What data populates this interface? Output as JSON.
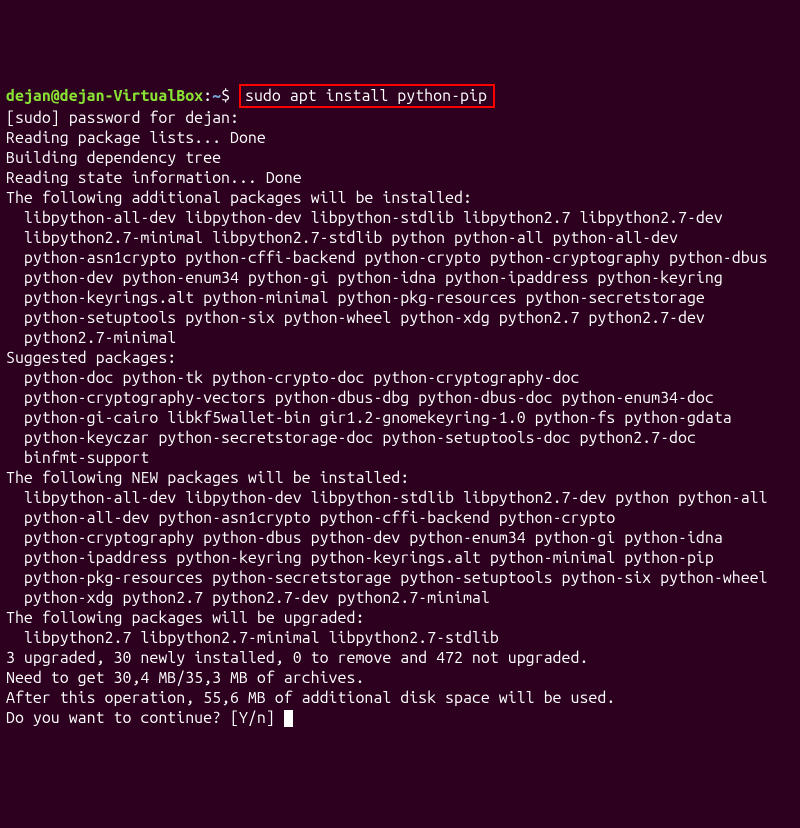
{
  "prompt": {
    "user": "dejan@dejan-VirtualBox",
    "separator": ":",
    "path": "~",
    "dollar": "$ "
  },
  "command": "sudo apt install python-pip",
  "lines": [
    "[sudo] password for dejan:",
    "Reading package lists... Done",
    "Building dependency tree",
    "Reading state information... Done",
    "The following additional packages will be installed:",
    "  libpython-all-dev libpython-dev libpython-stdlib libpython2.7 libpython2.7-dev",
    "  libpython2.7-minimal libpython2.7-stdlib python python-all python-all-dev",
    "  python-asn1crypto python-cffi-backend python-crypto python-cryptography python-dbus",
    "  python-dev python-enum34 python-gi python-idna python-ipaddress python-keyring",
    "  python-keyrings.alt python-minimal python-pkg-resources python-secretstorage",
    "  python-setuptools python-six python-wheel python-xdg python2.7 python2.7-dev",
    "  python2.7-minimal",
    "Suggested packages:",
    "  python-doc python-tk python-crypto-doc python-cryptography-doc",
    "  python-cryptography-vectors python-dbus-dbg python-dbus-doc python-enum34-doc",
    "  python-gi-cairo libkf5wallet-bin gir1.2-gnomekeyring-1.0 python-fs python-gdata",
    "  python-keyczar python-secretstorage-doc python-setuptools-doc python2.7-doc",
    "  binfmt-support",
    "The following NEW packages will be installed:",
    "  libpython-all-dev libpython-dev libpython-stdlib libpython2.7-dev python python-all",
    "  python-all-dev python-asn1crypto python-cffi-backend python-crypto",
    "  python-cryptography python-dbus python-dev python-enum34 python-gi python-idna",
    "  python-ipaddress python-keyring python-keyrings.alt python-minimal python-pip",
    "  python-pkg-resources python-secretstorage python-setuptools python-six python-wheel",
    "  python-xdg python2.7 python2.7-dev python2.7-minimal",
    "The following packages will be upgraded:",
    "  libpython2.7 libpython2.7-minimal libpython2.7-stdlib",
    "3 upgraded, 30 newly installed, 0 to remove and 472 not upgraded.",
    "Need to get 30,4 MB/35,3 MB of archives.",
    "After this operation, 55,6 MB of additional disk space will be used.",
    "Do you want to continue? [Y/n] "
  ]
}
